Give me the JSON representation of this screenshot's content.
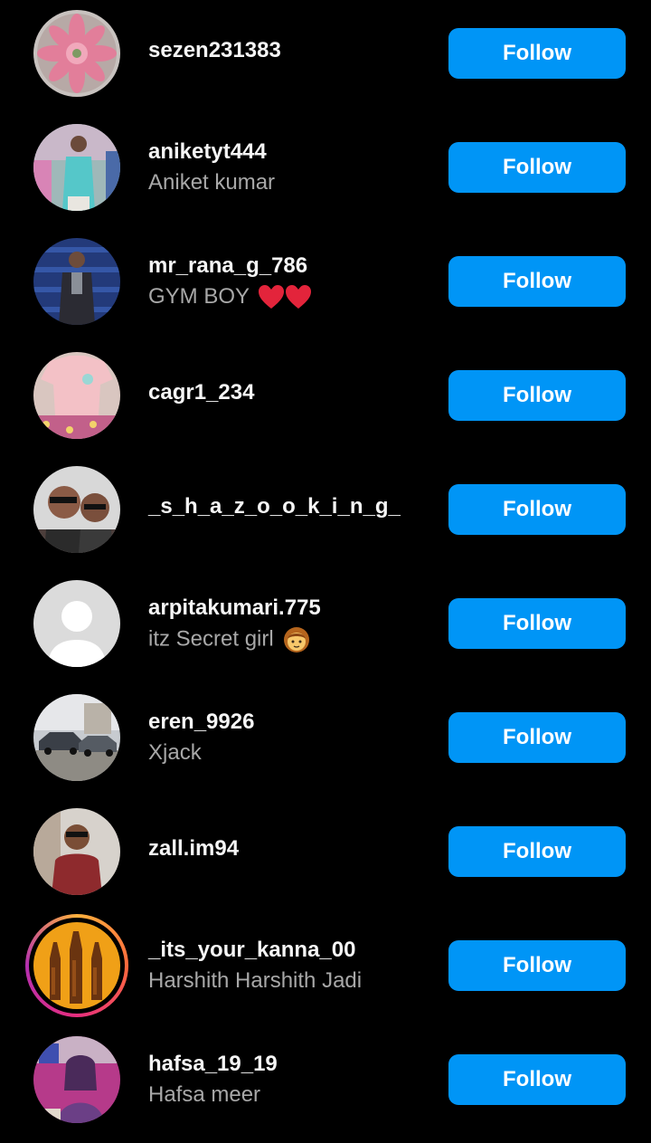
{
  "follow_label": "Follow",
  "accent_color": "#0095f6",
  "users": [
    {
      "username": "sezen231383",
      "fullname": ""
    },
    {
      "username": "aniketyt444",
      "fullname": "Aniket kumar"
    },
    {
      "username": "mr_rana_g_786",
      "fullname": "GYM BOY"
    },
    {
      "username": "cagr1_234",
      "fullname": ""
    },
    {
      "username": "_s_h_a_z_o_o_k_i_n_g_",
      "fullname": ""
    },
    {
      "username": "arpitakumari.775",
      "fullname": "itz Secret girl"
    },
    {
      "username": "eren_9926",
      "fullname": "Xjack"
    },
    {
      "username": "zall.im94",
      "fullname": ""
    },
    {
      "username": "_its_your_kanna_00",
      "fullname": "Harshith Harshith Jadi"
    },
    {
      "username": "hafsa_19_19",
      "fullname": "Hafsa meer"
    }
  ]
}
